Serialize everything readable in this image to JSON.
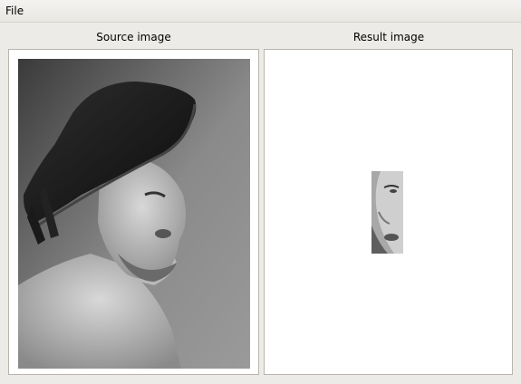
{
  "menubar": {
    "file_label": "File"
  },
  "source_panel": {
    "title": "Source image",
    "image_icon": "portrait-photo-grayscale"
  },
  "result_panel": {
    "title": "Result image",
    "image_icon": "cropped-face-grayscale"
  }
}
